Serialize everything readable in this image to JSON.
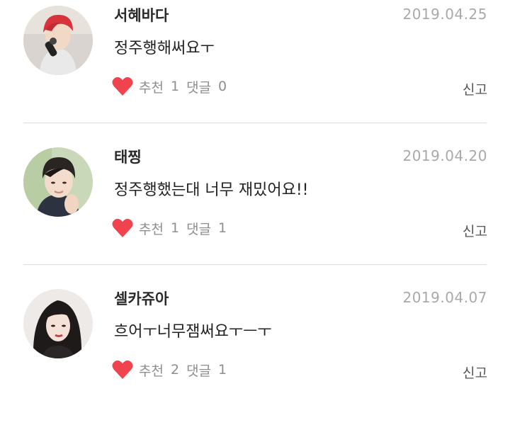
{
  "comments": [
    {
      "author": "서혜바다",
      "date": "2019.04.25",
      "text": "정주행해써요ㅜ",
      "like_label": "추천",
      "like_count": "1",
      "reply_label": "댓글",
      "reply_count": "0",
      "report_label": "신고"
    },
    {
      "author": "태찡",
      "date": "2019.04.20",
      "text": "정주행했는대 너무 재밌어요!!",
      "like_label": "추천",
      "like_count": "1",
      "reply_label": "댓글",
      "reply_count": "1",
      "report_label": "신고"
    },
    {
      "author": "셀카쥬아",
      "date": "2019.04.07",
      "text": "흐어ㅜ너무잼써요ㅜㅡㅜ",
      "like_label": "추천",
      "like_count": "2",
      "reply_label": "댓글",
      "reply_count": "1",
      "report_label": "신고"
    }
  ],
  "colors": {
    "heart": "#f0434d",
    "date": "#a9a9a9",
    "meta": "#8e8e8e",
    "divider": "#dedede"
  },
  "icons": {
    "like": "heart-icon"
  }
}
